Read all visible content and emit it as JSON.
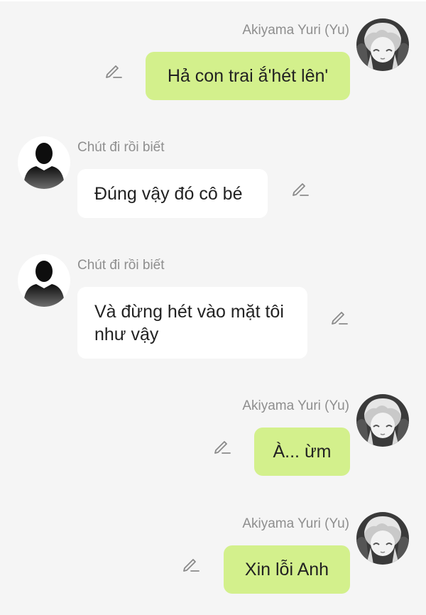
{
  "messages": [
    {
      "sender": "Akiyama Yuri (Yu)",
      "text": "Hả con trai ắ'hét lên'",
      "side": "right",
      "avatar": "anime-girl-avatar"
    },
    {
      "sender": "Chút đi rồi biết",
      "text": "Đúng vậy đó cô bé",
      "side": "left",
      "avatar": "silhouette-avatar"
    },
    {
      "sender": "Chút đi rồi biết",
      "text": "Và đừng hét vào mặt tôi như vậy",
      "side": "left",
      "avatar": "silhouette-avatar"
    },
    {
      "sender": "Akiyama Yuri (Yu)",
      "text": "À... ừm",
      "side": "right",
      "avatar": "anime-girl-avatar"
    },
    {
      "sender": "Akiyama Yuri (Yu)",
      "text": "Xin lỗi Anh",
      "side": "right",
      "avatar": "anime-girl-avatar"
    }
  ],
  "colors": {
    "background": "#f5f5f5",
    "own_bubble": "#d3f08c",
    "other_bubble": "#ffffff",
    "sender_name": "#8e8e8e",
    "message_text": "#222222"
  },
  "icons": {
    "edit": "pencil-edit-icon"
  }
}
